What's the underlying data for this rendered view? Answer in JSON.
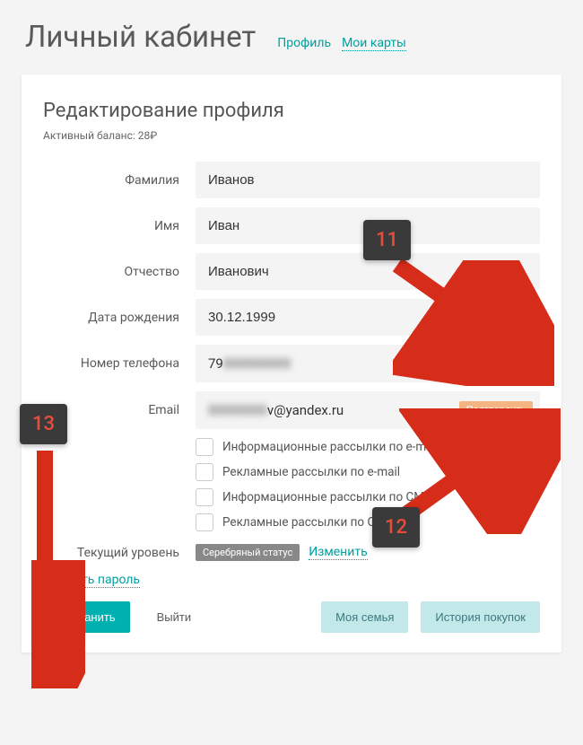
{
  "header": {
    "title": "Личный кабинет",
    "nav_profile": "Профиль",
    "nav_cards": "Мои карты"
  },
  "card": {
    "title": "Редактирование профиля",
    "balance": "Активный баланс: 28₽"
  },
  "labels": {
    "lastname": "Фамилия",
    "firstname": "Имя",
    "patronymic": "Отчество",
    "birthdate": "Дата рождения",
    "phone": "Номер телефона",
    "email": "Email",
    "level": "Текущий уровень"
  },
  "values": {
    "lastname": "Иванов",
    "firstname": "Иван",
    "patronymic": "Иванович",
    "birthdate": "30.12.1999",
    "phone_prefix": "79",
    "phone_hidden": "XXXXXXXX",
    "email_hidden": "XXXXXXX",
    "email_suffix": "v@yandex.ru"
  },
  "buttons": {
    "confirm": "Подтвердить",
    "save": "Сохранить",
    "logout": "Выйти",
    "family": "Моя семья",
    "history": "История покупок"
  },
  "checkboxes": {
    "info_email": "Информационные рассылки по e-mail",
    "ads_email": "Рекламные рассылки по e-mail",
    "info_sms": "Информационные рассылки по СМС",
    "ads_sms": "Рекламные рассылки по СМС"
  },
  "status": {
    "badge": "Серебряный статус",
    "change": "Изменить"
  },
  "links": {
    "change_password": "Сменить пароль"
  },
  "annotations": {
    "a11": "11",
    "a12": "12",
    "a13": "13"
  }
}
